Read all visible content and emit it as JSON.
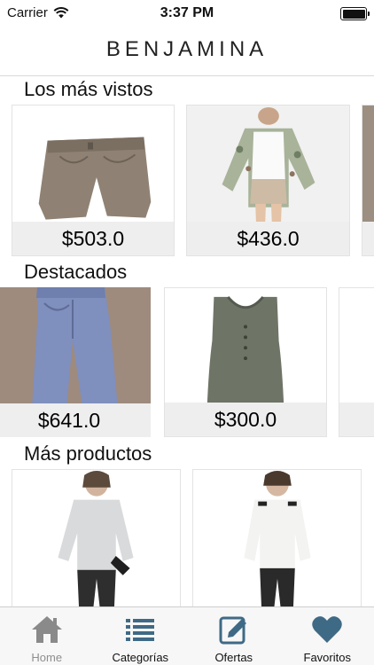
{
  "status_bar": {
    "carrier": "Carrier",
    "time": "3:37 PM",
    "battery_level": 1.0
  },
  "nav": {
    "title": "BENJAMINA"
  },
  "sections": {
    "most_viewed": {
      "title": "Los más vistos",
      "items": [
        {
          "price": "$503.0",
          "image": "khaki-shorts"
        },
        {
          "price": "$436.0",
          "image": "floral-jacket-outfit"
        }
      ]
    },
    "featured": {
      "title": "Destacados",
      "items": [
        {
          "price": "$641.0",
          "image": "denim-pants"
        },
        {
          "price": "$300.0",
          "image": "olive-tank-top"
        }
      ]
    },
    "more": {
      "title": "Más productos",
      "items": [
        {
          "image": "grey-sweater-outfit"
        },
        {
          "image": "white-blouse-outfit"
        }
      ]
    }
  },
  "tabbar": {
    "tabs": [
      {
        "label": "Home",
        "icon": "home-icon",
        "active": true
      },
      {
        "label": "Categorías",
        "icon": "list-icon",
        "active": false
      },
      {
        "label": "Ofertas",
        "icon": "pencil-icon",
        "active": false
      },
      {
        "label": "Favoritos",
        "icon": "heart-icon",
        "active": false
      }
    ]
  },
  "colors": {
    "icon_active": "#8a8a8a",
    "icon_inactive": "#3f6a86",
    "price_band": "#eeeeee"
  }
}
